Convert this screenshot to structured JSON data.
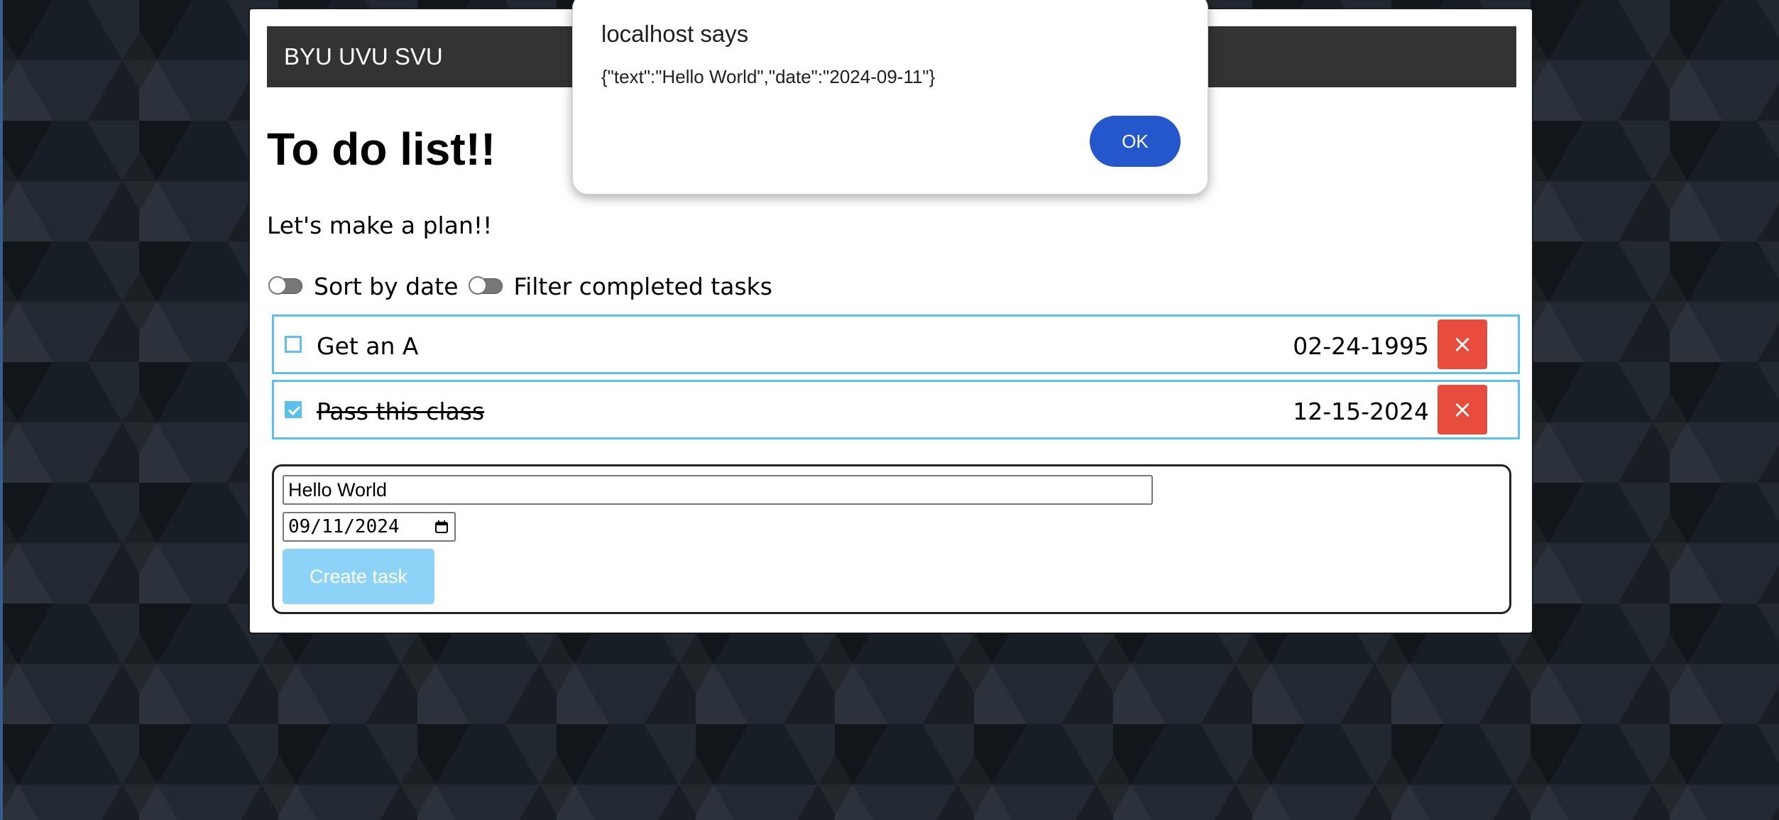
{
  "header": {
    "brand": "BYU UVU SVU"
  },
  "main": {
    "title": "To do list!!",
    "subtitle": "Let's make a plan!!",
    "toggles": [
      {
        "label": "Sort by date",
        "on": false
      },
      {
        "label": "Filter completed tasks",
        "on": false
      }
    ]
  },
  "tasks": [
    {
      "text": "Get an A",
      "date": "02-24-1995",
      "completed": false,
      "delete_icon": "×"
    },
    {
      "text": "Pass this class",
      "date": "12-15-2024",
      "completed": true,
      "delete_icon": "×"
    }
  ],
  "form": {
    "text_value": "Hello World",
    "date_value": "09/11/2024",
    "date_raw": "2024-09-11",
    "create_label": "Create task"
  },
  "alert": {
    "title": "localhost says",
    "message": "{\"text\":\"Hello World\",\"date\":\"2024-09-11\"}",
    "ok_label": "OK"
  },
  "colors": {
    "accent": "#5bc0eb",
    "danger": "#e74c3c",
    "header_bg": "#333333",
    "create_button_disabled": "#8dd3f7",
    "dialog_button": "#2456cc"
  },
  "icons": {
    "delete": "close-icon",
    "date_picker": "calendar-icon",
    "checkbox_checked": "checkmark-icon"
  }
}
